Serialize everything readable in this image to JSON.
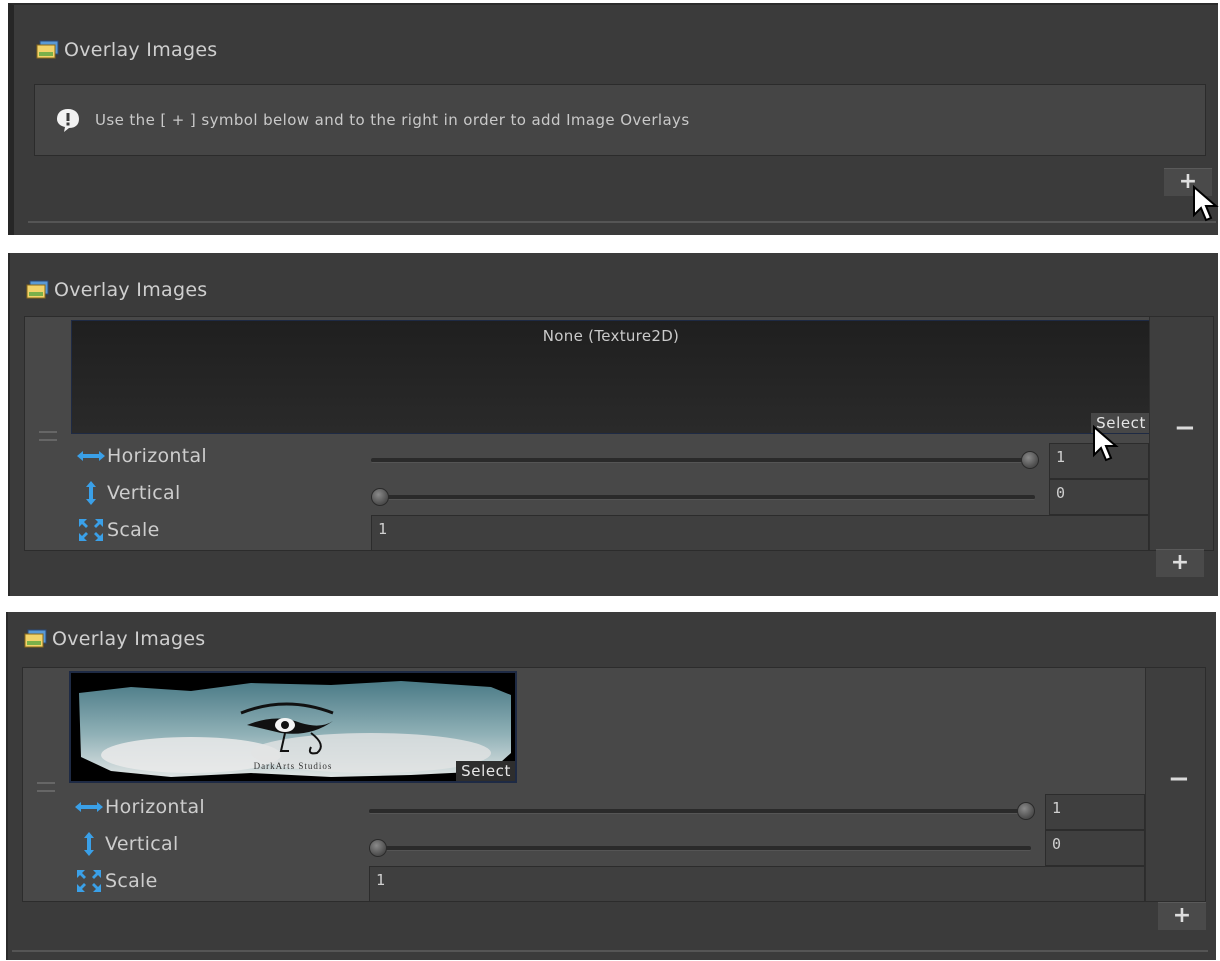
{
  "panels": [
    {
      "title": "Overlay Images",
      "help_text": "Use the [ + ] symbol below and to the right in order to add Image Overlays",
      "add_label": "+"
    },
    {
      "title": "Overlay Images",
      "texture_value": "None (Texture2D)",
      "select_label": "Select",
      "remove_label": "−",
      "add_label": "+",
      "horizontal": {
        "label": "Horizontal",
        "value": "1",
        "slider_fraction": 1.0
      },
      "vertical": {
        "label": "Vertical",
        "value": "0",
        "slider_fraction": 0.0
      },
      "scale": {
        "label": "Scale",
        "value": "1"
      }
    },
    {
      "title": "Overlay Images",
      "select_label": "Select",
      "image_logo_text": "DarkArts Studios",
      "remove_label": "−",
      "add_label": "+",
      "horizontal": {
        "label": "Horizontal",
        "value": "1",
        "slider_fraction": 1.0
      },
      "vertical": {
        "label": "Vertical",
        "value": "0",
        "slider_fraction": 0.0
      },
      "scale": {
        "label": "Scale",
        "value": "1"
      }
    }
  ],
  "icons": {
    "overlay": "overlay-images-icon",
    "warning": "exclamation-icon",
    "horizontal": "horizontal-arrow-icon",
    "vertical": "vertical-arrow-icon",
    "scale": "scale-arrows-icon"
  },
  "colors": {
    "panel_bg": "#3b3b3b",
    "accent_blue": "#3aa0e8"
  }
}
